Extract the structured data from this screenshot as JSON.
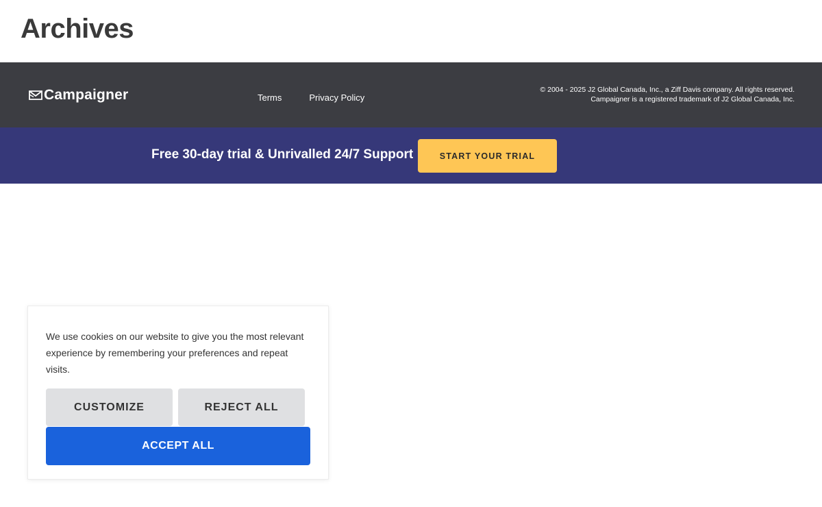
{
  "page": {
    "title": "Archives"
  },
  "footer": {
    "logo": {
      "icon": "envelope-icon",
      "text": "Campaigner"
    },
    "links": [
      {
        "label": "Terms"
      },
      {
        "label": "Privacy Policy"
      }
    ],
    "copyright_line1": "© 2004 - 2025 J2 Global Canada, Inc., a Ziff Davis company. All rights reserved.",
    "copyright_line2": "Campaigner is a registered trademark of J2 Global Canada, Inc."
  },
  "promo": {
    "text": "Free 30-day trial & Unrivalled 24/7 Support",
    "button_label": "START YOUR TRIAL"
  },
  "cookie_banner": {
    "message": "We use cookies on our website to give you the most relevant experience by remembering your preferences and repeat visits.",
    "customize_label": "CUSTOMIZE",
    "reject_label": "REJECT ALL",
    "accept_label": "ACCEPT ALL"
  },
  "colors": {
    "footer_bg": "#3c3d42",
    "promo_bg": "#363879",
    "trial_button": "#fec655",
    "accept_button": "#1a62dc",
    "secondary_button": "#dfe0e2"
  }
}
